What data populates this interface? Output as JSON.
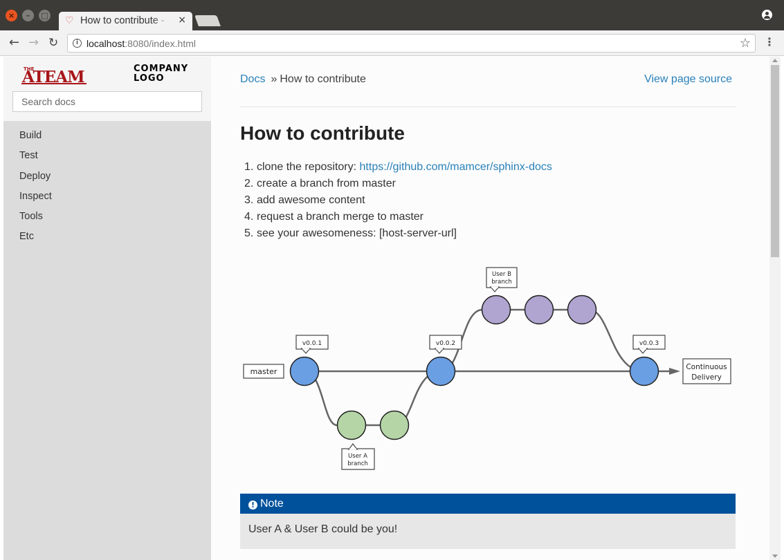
{
  "browser": {
    "tab_title": "How to contribute - ",
    "tab_close": "×",
    "url_host": "localhost",
    "url_rest": ":8080/index.html"
  },
  "sidebar": {
    "logo_brand": "ATEAM",
    "logo_brand_small": "THE",
    "logo_text": "COMPANY\nLOGO",
    "search_placeholder": "Search docs",
    "items": [
      "Build",
      "Test",
      "Deploy",
      "Inspect",
      "Tools",
      "Etc"
    ]
  },
  "breadcrumbs": {
    "root": "Docs",
    "sep": "»",
    "current": "How to contribute",
    "source_link": "View page source"
  },
  "page": {
    "title": "How to contribute",
    "steps": [
      {
        "num": "1.",
        "text": "clone the repository: ",
        "link": "https://github.com/mamcer/sphinx-docs"
      },
      {
        "num": "2.",
        "text": "create a branch from master"
      },
      {
        "num": "3.",
        "text": "add awesome content"
      },
      {
        "num": "4.",
        "text": "request a branch merge to master"
      },
      {
        "num": "5.",
        "text": "see your awesomeness: [host-server-url]"
      }
    ]
  },
  "diagram": {
    "master_label": "master",
    "tags": [
      "v0.0.1",
      "v0.0.2",
      "v0.0.3"
    ],
    "user_a_label": [
      "User A",
      "branch"
    ],
    "user_b_label": [
      "User B",
      "branch"
    ],
    "target_label": [
      "Continuous",
      "Delivery"
    ],
    "colors": {
      "master": "#6a9fe3",
      "user_a": "#b5d5a7",
      "user_b": "#b0a5d0",
      "line": "#666666"
    }
  },
  "note": {
    "title": "Note",
    "body": "User A & User B could be you!",
    "color": "#00519c"
  }
}
